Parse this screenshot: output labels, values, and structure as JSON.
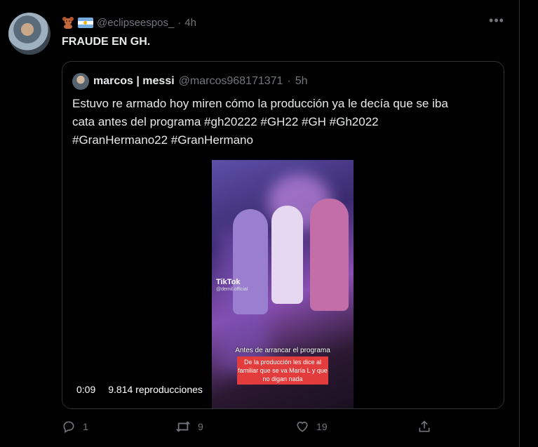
{
  "tweet": {
    "handle": "@eclipseespos_",
    "dot": "·",
    "time": "4h",
    "more": "•••",
    "text": "FRAUDE EN GH."
  },
  "quote": {
    "name": "marcos | messi",
    "handle": "@marcos968171371",
    "dot": "·",
    "time": "5h",
    "text_lines": [
      "Estuvo re armado hoy miren cómo la producción ya le decía que se iba",
      "cata antes del programa  #gh20222 #GH22 #GH #Gh2022",
      "#GranHermano22 #GranHermano"
    ],
    "video": {
      "duration": "0:09",
      "views": "9.814 reproducciones",
      "overlay_logo": "TikTok",
      "overlay_user": "@demil.official",
      "caption_top": "Antes de arrancar el programa",
      "caption_box": "De la producción les dice al familiar que se va María L y que no digan nada"
    }
  },
  "actions": {
    "reply_count": "1",
    "retweet_count": "9",
    "like_count": "19"
  },
  "colors": {
    "background": "#000000",
    "text": "#e7e9ea",
    "muted": "#71767b",
    "border": "#2f3336"
  }
}
